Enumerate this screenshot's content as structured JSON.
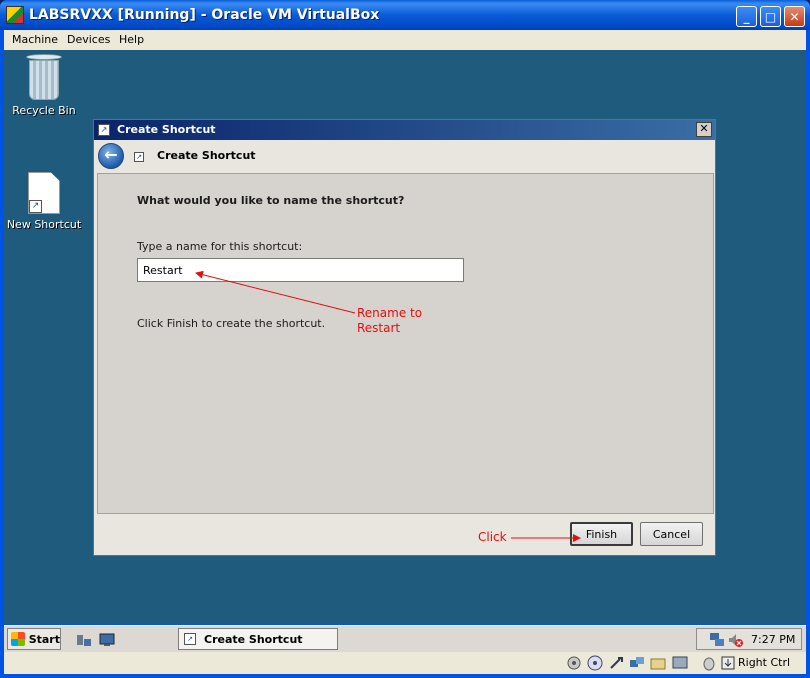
{
  "host": {
    "title": "LABSRVXX [Running] - Oracle VM VirtualBox",
    "menu": [
      "Machine",
      "Devices",
      "Help"
    ],
    "window_buttons": {
      "minimize": "_",
      "maximize": "□",
      "close": "✕"
    },
    "status_host_key": "Right Ctrl"
  },
  "desktop": {
    "icons": [
      {
        "label": "Recycle Bin",
        "icon": "recycle-bin-icon"
      },
      {
        "label": "New Shortcut",
        "icon": "shortcut-file-icon"
      }
    ]
  },
  "dialog": {
    "window_title": "Create Shortcut",
    "header_title": "Create Shortcut",
    "question": "What would you like to name the shortcut?",
    "name_label": "Type a name for this shortcut:",
    "name_value": "Restart",
    "finish_hint": "Click Finish to create the shortcut.",
    "buttons": {
      "finish": "Finish",
      "cancel": "Cancel"
    },
    "close_glyph": "✕",
    "back_glyph": "←"
  },
  "annotations": {
    "rename": [
      "Rename to",
      "Restart"
    ],
    "click": "Click",
    "color": "#e01010"
  },
  "taskbar": {
    "start_label": "Start",
    "task_label": "Create Shortcut",
    "clock": "7:27 PM"
  },
  "colors": {
    "desktop": "#1e5b7d",
    "xp_title": "#0054e3",
    "dialog_title": "#0a246a"
  }
}
